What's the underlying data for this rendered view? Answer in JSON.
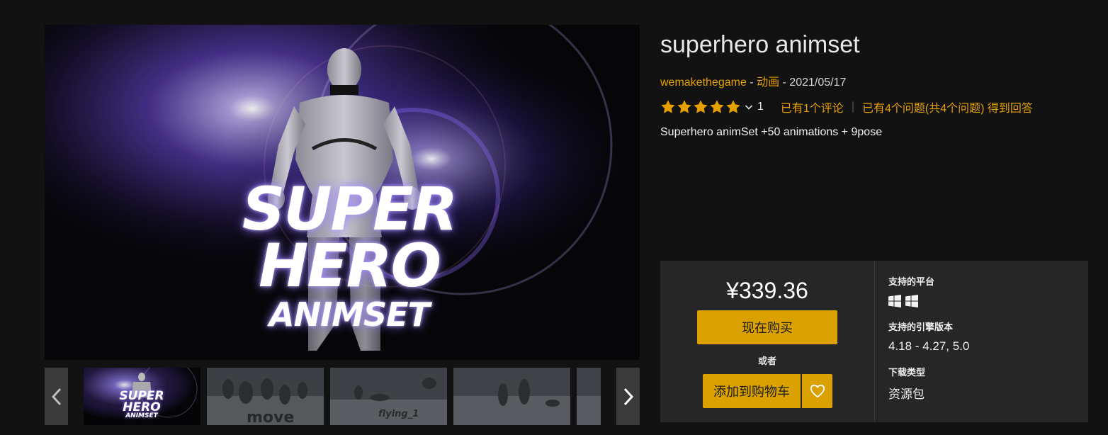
{
  "hero": {
    "title_line1": "SUPER",
    "title_line2": "HERO",
    "title_line3": "ANIMSET"
  },
  "thumbnails": [
    {
      "kind": "cover",
      "line1": "SUPER",
      "line2": "HERO",
      "line3": "ANIMSET"
    },
    {
      "kind": "scene",
      "floor_text": "move"
    },
    {
      "kind": "scene",
      "floor_text": "flying_1"
    },
    {
      "kind": "scene",
      "floor_text": ""
    },
    {
      "kind": "partial"
    }
  ],
  "product": {
    "title": "superhero animset",
    "author": "wemakethegame",
    "category": "动画",
    "date": "2021/05/17",
    "meta_sep": " - ",
    "rating_count": "1",
    "reviews_link": "已有1个评论",
    "questions_link": "已有4个问题(共4个问题) 得到回答",
    "description": "Superhero animSet +50 animations + 9pose"
  },
  "purchase": {
    "price": "¥339.36",
    "buy_label": "现在购买",
    "or_label": "或者",
    "cart_label": "添加到购物车"
  },
  "specs": {
    "platform_label": "支持的平台",
    "engine_label": "支持的引擎版本",
    "engine_value": "4.18 - 4.27, 5.0",
    "download_label": "下载类型",
    "download_value": "资源包"
  },
  "colors": {
    "accent": "#e6a100",
    "button": "#dba100",
    "background": "#121212",
    "panel": "#262626"
  }
}
